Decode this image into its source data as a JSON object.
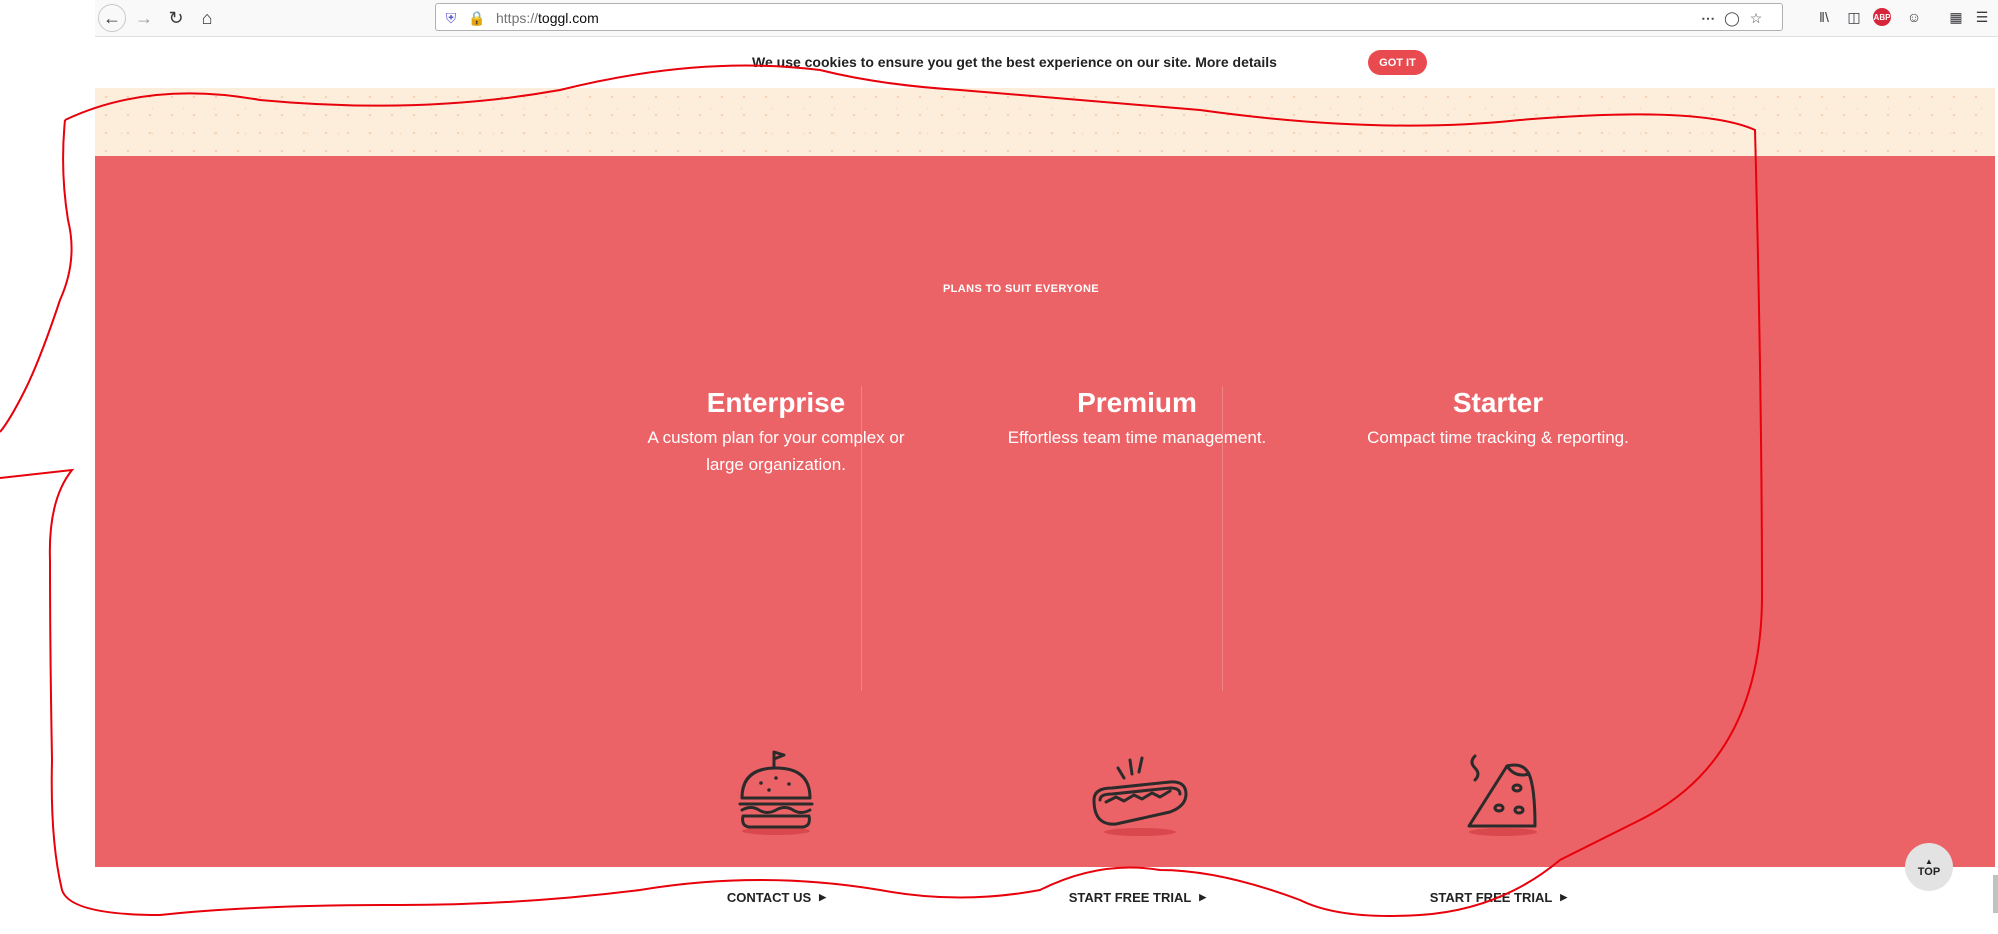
{
  "browser": {
    "url_protocol": "https://",
    "url_host": "toggl.com",
    "back_icon": "arrow-left-icon",
    "forward_icon": "arrow-right-icon",
    "reload_icon": "reload-icon",
    "home_icon": "home-icon",
    "more_icon": "more-dots-icon",
    "pocket_icon": "pocket-icon",
    "bookmark_icon": "star-icon",
    "abp_label": "ABP"
  },
  "cookie_banner": {
    "text": "We use cookies to ensure you get the best experience on our site. More details",
    "button_label": "GOT IT"
  },
  "plans": {
    "heading": "PLANS TO SUIT EVERYONE",
    "items": [
      {
        "name": "Enterprise",
        "description": "A custom plan for your complex or large organization.",
        "cta": "CONTACT US",
        "illustration": "burger-icon"
      },
      {
        "name": "Premium",
        "description": "Effortless team time management.",
        "cta": "START FREE TRIAL",
        "illustration": "hotdog-icon"
      },
      {
        "name": "Starter",
        "description": "Compact time tracking & reporting.",
        "cta": "START FREE TRIAL",
        "illustration": "pizza-slice-icon"
      }
    ]
  },
  "top_button": {
    "label": "TOP"
  },
  "colors": {
    "section_red": "#ec6367",
    "accent": "#e84a4f",
    "cream": "#fdeedc",
    "ink": "#e8000b"
  }
}
